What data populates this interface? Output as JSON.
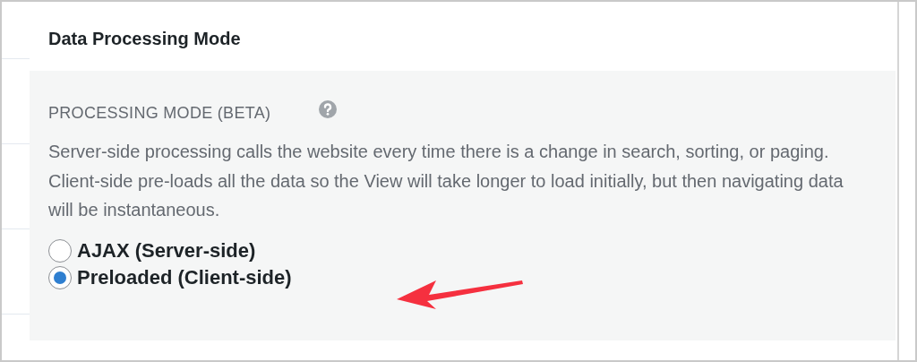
{
  "section": {
    "title": "Data Processing Mode"
  },
  "setting": {
    "label": "PROCESSING MODE (BETA)",
    "help": true,
    "description": "Server-side processing calls the website every time there is a change in search, sorting, or paging. Client-side pre-loads all the data so the View will take longer to load initially, but then navigating data will be instantaneous.",
    "options": [
      {
        "label": "AJAX (Server-side)",
        "selected": false
      },
      {
        "label": "Preloaded (Client-side)",
        "selected": true
      }
    ]
  }
}
